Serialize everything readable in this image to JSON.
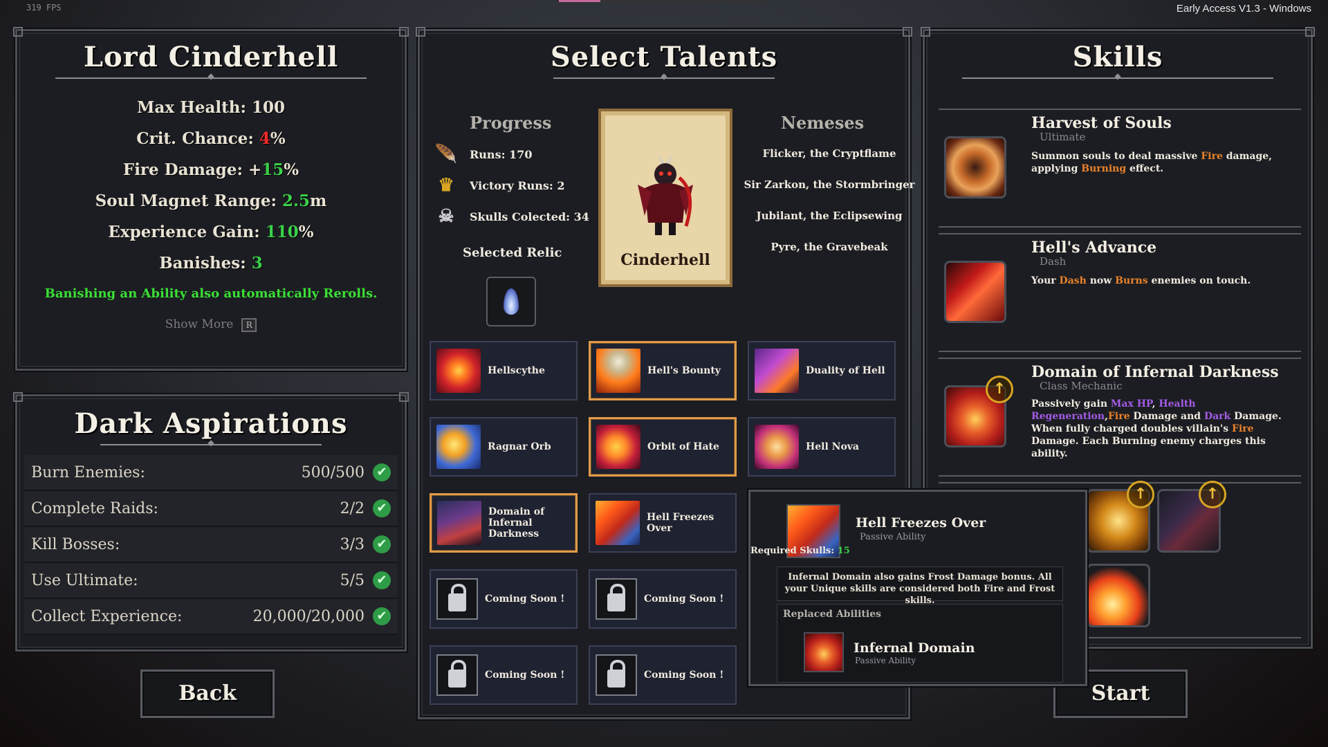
{
  "hud": {
    "fps": "319 FPS",
    "version": "Early Access V1.3 - Windows"
  },
  "character": {
    "title": "Lord Cinderhell",
    "stats": {
      "max_health_label": "Max Health: ",
      "max_health": "100",
      "crit_label": "Crit. Chance: ",
      "crit_value": "4",
      "crit_suffix": "%",
      "fire_label": "Fire Damage: +",
      "fire_value": "15",
      "fire_suffix": "%",
      "soul_label": "Soul Magnet Range: ",
      "soul_value": "2.5",
      "soul_suffix": "m",
      "xp_label": "Experience Gain: ",
      "xp_value": "110",
      "xp_suffix": "%",
      "banish_label": "Banishes: ",
      "banish_value": "3"
    },
    "note": "Banishing an Ability also automatically Rerolls.",
    "show_more": "Show More",
    "show_more_key": "R"
  },
  "aspirations": {
    "title": "Dark Aspirations",
    "items": [
      {
        "label": "Burn Enemies:",
        "value": "500/500"
      },
      {
        "label": "Complete Raids:",
        "value": "2/2"
      },
      {
        "label": "Kill Bosses:",
        "value": "3/3"
      },
      {
        "label": "Use Ultimate:",
        "value": "5/5"
      },
      {
        "label": "Collect Experience:",
        "value": "20,000/20,000"
      }
    ]
  },
  "buttons": {
    "back": "Back",
    "start": "Start"
  },
  "talents": {
    "title": "Select Talents",
    "progress_header": "Progress",
    "nemeses_header": "Nemeses",
    "progress": [
      {
        "icon": "feather-icon",
        "text": "Runs: 170"
      },
      {
        "icon": "crown-icon",
        "text": "Victory Runs: 2"
      },
      {
        "icon": "skull-icon",
        "text": "Skulls Colected: 34"
      }
    ],
    "selected_relic_label": "Selected Relic",
    "card_name": "Cinderhell",
    "nemeses": [
      "Flicker, the Cryptflame",
      "Sir Zarkon, the Stormbringer",
      "Jubilant, the Eclipsewing",
      "Pyre, the Gravebeak"
    ],
    "tiles": [
      {
        "label": "Hellscythe",
        "icon": "g-scythe",
        "selected": false
      },
      {
        "label": "Hell's Bounty",
        "icon": "g-bounty",
        "selected": true
      },
      {
        "label": "Duality of Hell",
        "icon": "g-duality",
        "selected": false
      },
      {
        "label": "Ragnar Orb",
        "icon": "g-ragnar",
        "selected": false
      },
      {
        "label": "Orbit of Hate",
        "icon": "g-orbit",
        "selected": true
      },
      {
        "label": "Hell Nova",
        "icon": "g-nova",
        "selected": false
      },
      {
        "label": "Domain of Infernal Darkness",
        "icon": "g-domain",
        "selected": true
      },
      {
        "label": "Hell Freezes Over",
        "icon": "g-freeze",
        "selected": false
      },
      {
        "label": "Coming Soon !",
        "icon": "lock",
        "selected": false
      },
      {
        "label": "Coming Soon !",
        "icon": "lock",
        "selected": false
      },
      {
        "label": "Coming Soon !",
        "icon": "lock",
        "selected": false
      },
      {
        "label": "Coming Soon !",
        "icon": "lock",
        "selected": false
      }
    ]
  },
  "skills": {
    "title": "Skills",
    "harvest": {
      "name": "Harvest of Souls",
      "type": "Ultimate",
      "d1": "Summon souls to deal massive ",
      "d2": "Fire",
      "d3": " damage, applying ",
      "d4": "Burning",
      "d5": " effect."
    },
    "advance": {
      "name": "Hell's Advance",
      "type": "Dash",
      "d1": "Your ",
      "d2": "Dash",
      "d3": " now ",
      "d4": "Burns",
      "d5": " enemies on touch."
    },
    "domain": {
      "name": "Domain of Infernal Darkness",
      "type": "Class Mechanic",
      "d1": "Passively gain ",
      "d2": "Max HP",
      "d3": ", ",
      "d4": "Health Regeneration",
      "d5": ",",
      "d6": "Fire",
      "d7": " Damage and ",
      "d8": "Dark",
      "d9": " Damage. When fully charged doubles villain's ",
      "d10": "Fire",
      "d11": " Damage. Each Burning enemy charges this ability."
    },
    "upgrade_glyph": "↑"
  },
  "tooltip": {
    "name": "Hell Freezes Over",
    "type": "Passive Ability",
    "req_label": "Required Skulls: ",
    "req_value": "15",
    "desc": "Infernal Domain also gains Frost Damage bonus. All your Unique skills are considered both Fire and Frost skills.",
    "replaced_header": "Replaced Abilities",
    "replaced_name": "Infernal Domain",
    "replaced_type": "Passive Ability"
  },
  "colors": {
    "accent_orange": "#e09b4a",
    "positive": "#3ad14a",
    "negative": "#ee2a2a",
    "fire": "#e9822b",
    "dark": "#a35ce6"
  }
}
